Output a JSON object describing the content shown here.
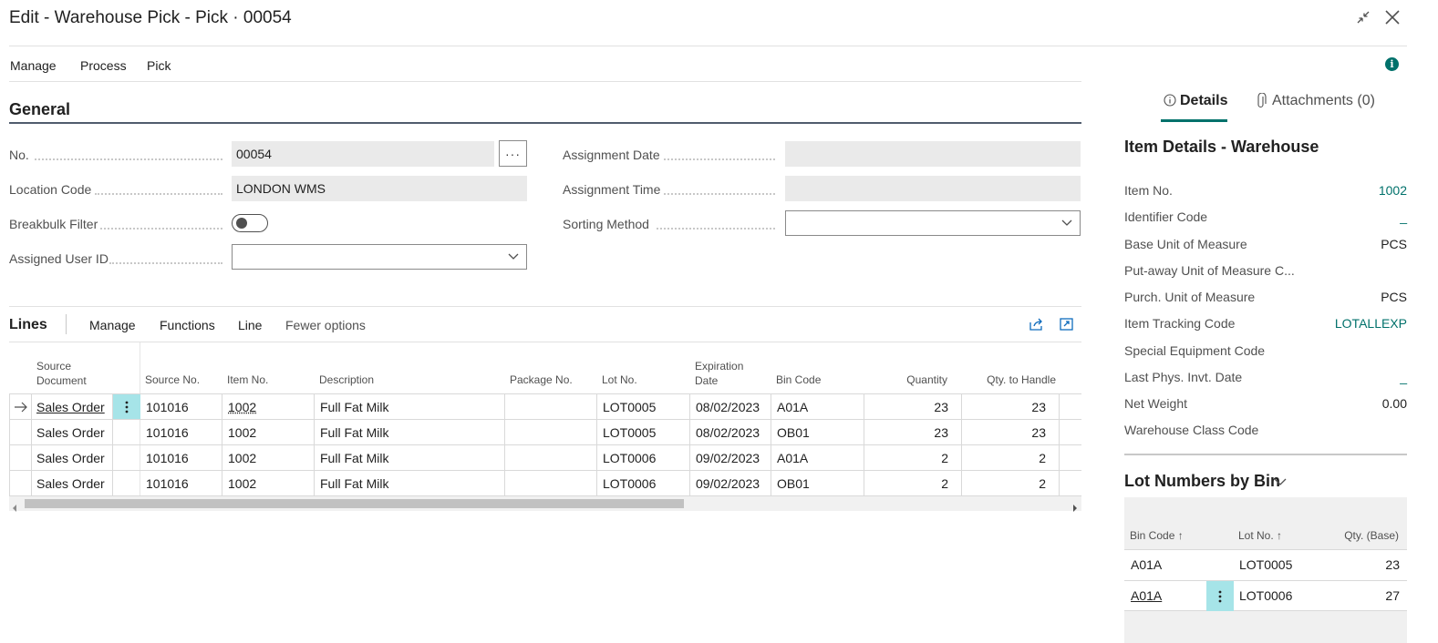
{
  "window": {
    "title": "Edit - Warehouse Pick - Pick · 00054",
    "collapse_icon": "collapse-arrows-icon",
    "close_icon": "close-icon"
  },
  "action_bar": {
    "items": [
      "Manage",
      "Process",
      "Pick"
    ],
    "info_icon": "info-icon",
    "info_glyph": "i"
  },
  "general": {
    "title": "General",
    "fields": {
      "no": {
        "label": "No.",
        "value": "00054"
      },
      "location_code": {
        "label": "Location Code",
        "value": "LONDON WMS"
      },
      "breakbulk_filter": {
        "label": "Breakbulk Filter",
        "value": false
      },
      "assigned_user_id": {
        "label": "Assigned User ID",
        "value": ""
      },
      "assignment_date": {
        "label": "Assignment Date",
        "value": ""
      },
      "assignment_time": {
        "label": "Assignment Time",
        "value": ""
      },
      "sorting_method": {
        "label": "Sorting Method",
        "value": ""
      }
    },
    "ellipsis": "···"
  },
  "lines": {
    "title": "Lines",
    "menu": [
      "Manage",
      "Functions",
      "Line",
      "Fewer options"
    ],
    "share_icon": "share-icon",
    "expand_icon": "expand-icon",
    "columns": {
      "source_document": [
        "Source",
        "Document"
      ],
      "source_no": "Source No.",
      "item_no": "Item No.",
      "description": "Description",
      "package_no": "Package No.",
      "lot_no": "Lot No.",
      "expiration_date": [
        "Expiration",
        "Date"
      ],
      "bin_code": "Bin Code",
      "quantity": "Quantity",
      "qty_to_handle": "Qty. to Handle"
    },
    "rows": [
      {
        "source_document": "Sales Order",
        "source_no": "101016",
        "item_no": "1002",
        "description": "Full Fat Milk",
        "package_no": "",
        "lot_no": "LOT0005",
        "expiration_date": "08/02/2023",
        "bin_code": "A01A",
        "quantity": "23",
        "qty_to_handle": "23"
      },
      {
        "source_document": "Sales Order",
        "source_no": "101016",
        "item_no": "1002",
        "description": "Full Fat Milk",
        "package_no": "",
        "lot_no": "LOT0005",
        "expiration_date": "08/02/2023",
        "bin_code": "OB01",
        "quantity": "23",
        "qty_to_handle": "23"
      },
      {
        "source_document": "Sales Order",
        "source_no": "101016",
        "item_no": "1002",
        "description": "Full Fat Milk",
        "package_no": "",
        "lot_no": "LOT0006",
        "expiration_date": "09/02/2023",
        "bin_code": "A01A",
        "quantity": "2",
        "qty_to_handle": "2"
      },
      {
        "source_document": "Sales Order",
        "source_no": "101016",
        "item_no": "1002",
        "description": "Full Fat Milk",
        "package_no": "",
        "lot_no": "LOT0006",
        "expiration_date": "09/02/2023",
        "bin_code": "OB01",
        "quantity": "2",
        "qty_to_handle": "2"
      }
    ]
  },
  "factbox": {
    "tabs": {
      "details": "Details",
      "attachments": "Attachments (0)"
    },
    "item_details": {
      "title": "Item Details - Warehouse",
      "rows": [
        {
          "label": "Item No.",
          "value": "1002"
        },
        {
          "label": "Identifier Code",
          "value": "_"
        },
        {
          "label": "Base Unit of Measure",
          "value": "PCS"
        },
        {
          "label": "Put-away Unit of Measure C...",
          "value": ""
        },
        {
          "label": "Purch. Unit of Measure",
          "value": "PCS"
        },
        {
          "label": "Item Tracking Code",
          "value": "LOTALLEXP"
        },
        {
          "label": "Special Equipment Code",
          "value": ""
        },
        {
          "label": "Last Phys. Invt. Date",
          "value": "_"
        },
        {
          "label": "Net Weight",
          "value": "0.00"
        },
        {
          "label": "Warehouse Class Code",
          "value": ""
        }
      ]
    },
    "lot_by_bin": {
      "title": "Lot Numbers by Bin",
      "columns": {
        "bin_code": "Bin Code ↑",
        "lot_no": "Lot No. ↑",
        "qty_base": "Qty. (Base)"
      },
      "rows": [
        {
          "bin_code": "A01A",
          "lot_no": "LOT0005",
          "qty_base": "23"
        },
        {
          "bin_code": "A01A",
          "lot_no": "LOT0006",
          "qty_base": "27"
        }
      ]
    }
  },
  "colors": {
    "accent": "#00716b",
    "selected_cell": "#a6e4e8",
    "field_bg": "#eaeaea"
  }
}
